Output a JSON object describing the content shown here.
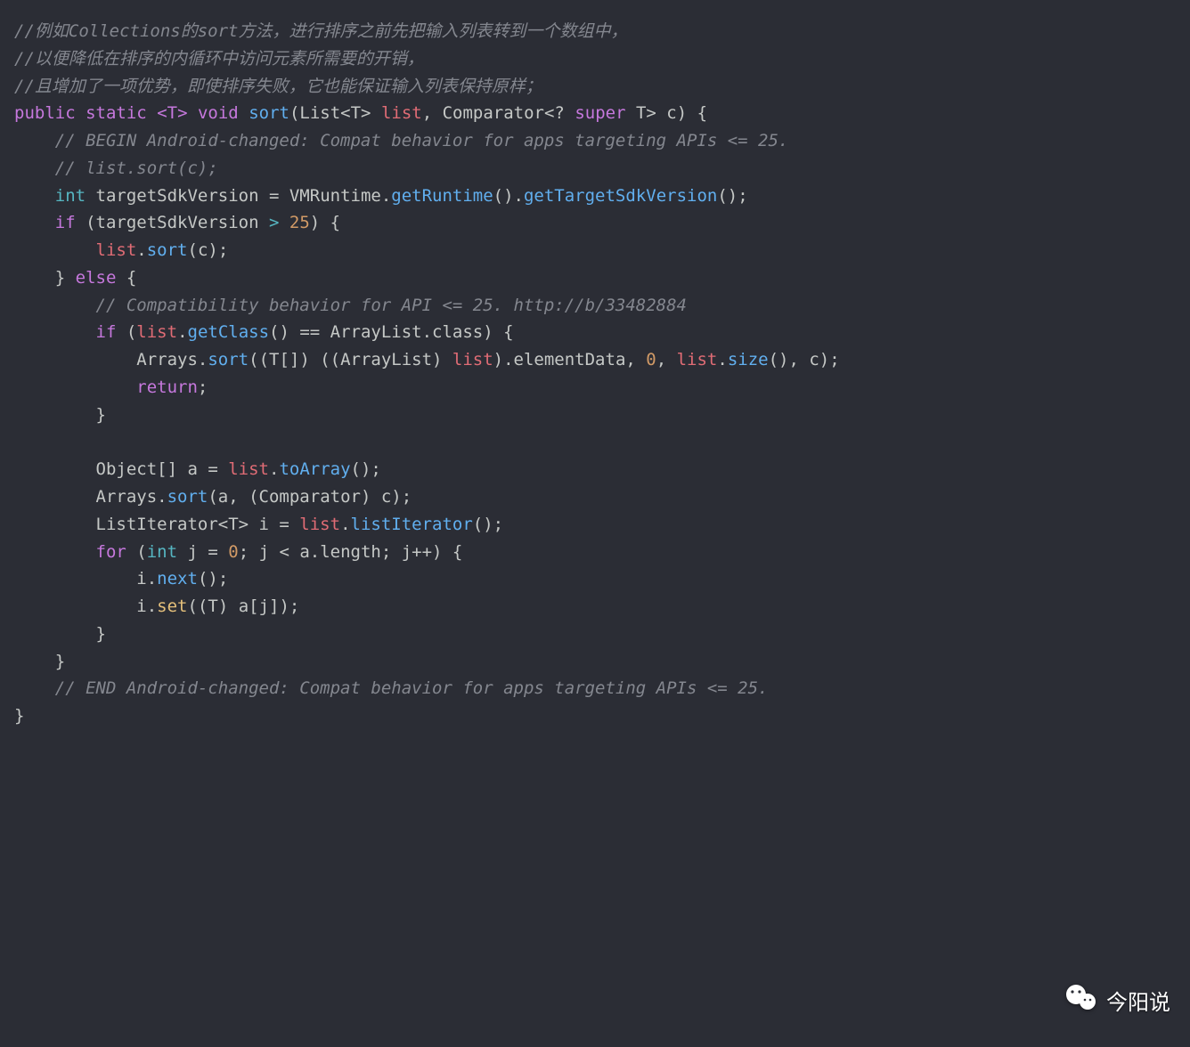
{
  "code": {
    "c1": "//例如Collections的sort方法，进行排序之前先把输入列表转到一个数组中，",
    "c2": "//以便降低在排序的内循环中访问元素所需要的开销，",
    "c3": "//且增加了一项优势，即使排序失败，它也能保证输入列表保持原样；",
    "sig": {
      "public": "public",
      "static": "static",
      "gen": "<T>",
      "void": "void",
      "name": "sort",
      "lp": "(",
      "p_list_t": "List<T>",
      "p_list_n": "list",
      "comma1": ", ",
      "p_cmp_t": "Comparator<? ",
      "p_super": "super",
      "p_T": " T>",
      "p_c": " c",
      "rp": ") {"
    },
    "c4": "// BEGIN Android-changed: Compat behavior for apps targeting APIs <= 25.",
    "c5": "// list.sort(c);",
    "l_tsv": {
      "int": "int",
      "name": " targetSdkVersion = VMRuntime.",
      "m1": "getRuntime",
      "mid": "().",
      "m2": "getTargetSdkVersion",
      "end": "();"
    },
    "l_if": {
      "if": "if",
      "cond_open": " (targetSdkVersion ",
      "op": ">",
      "sp": " ",
      "num": "25",
      "close": ") {"
    },
    "l_sort": {
      "list": "list",
      "dot": ".",
      "sort": "sort",
      "rest": "(c);"
    },
    "l_else_open": "} ",
    "else": "else",
    "l_else_close": " {",
    "c6": "// Compatibility behavior for API <= 25. http://b/33482884",
    "l_if2": {
      "if": "if",
      "open": " (",
      "list": "list",
      "mid": ".",
      "getClass": "getClass",
      "rest": "() == ArrayList.class) {"
    },
    "l_arrsort": {
      "pre": "Arrays.",
      "sort": "sort",
      "open": "((T[]) ((ArrayList) ",
      "list": "list",
      "mid": ").elementData, ",
      "zero": "0",
      "c": ", ",
      "list2": "list",
      "dot": ".",
      "size": "size",
      "end": "(), c);"
    },
    "l_return": "return",
    "l_return_sc": ";",
    "l_brace1": "}",
    "l_obj": {
      "pre": "Object[] a = ",
      "list": "list",
      "dot": ".",
      "toArray": "toArray",
      "end": "();"
    },
    "l_asort": {
      "pre": "Arrays.",
      "sort": "sort",
      "end": "(a, (Comparator) c);"
    },
    "l_li": {
      "pre": "ListIterator<T> i = ",
      "list": "list",
      "dot": ".",
      "m": "listIterator",
      "end": "();"
    },
    "l_for": {
      "for": "for",
      "open": " (",
      "int": "int",
      "j": " j = ",
      "zero": "0",
      "sc": "; j < a.length; j++) {"
    },
    "l_next": {
      "pre": "i.",
      "next": "next",
      "end": "();"
    },
    "l_set": {
      "pre": "i.",
      "set": "set",
      "end": "((T) a[j]);"
    },
    "l_brace2": "}",
    "l_brace3": "}",
    "c7": "// END Android-changed: Compat behavior for apps targeting APIs <= 25.",
    "l_brace4": "}"
  },
  "watermark": {
    "text": "今阳说"
  }
}
